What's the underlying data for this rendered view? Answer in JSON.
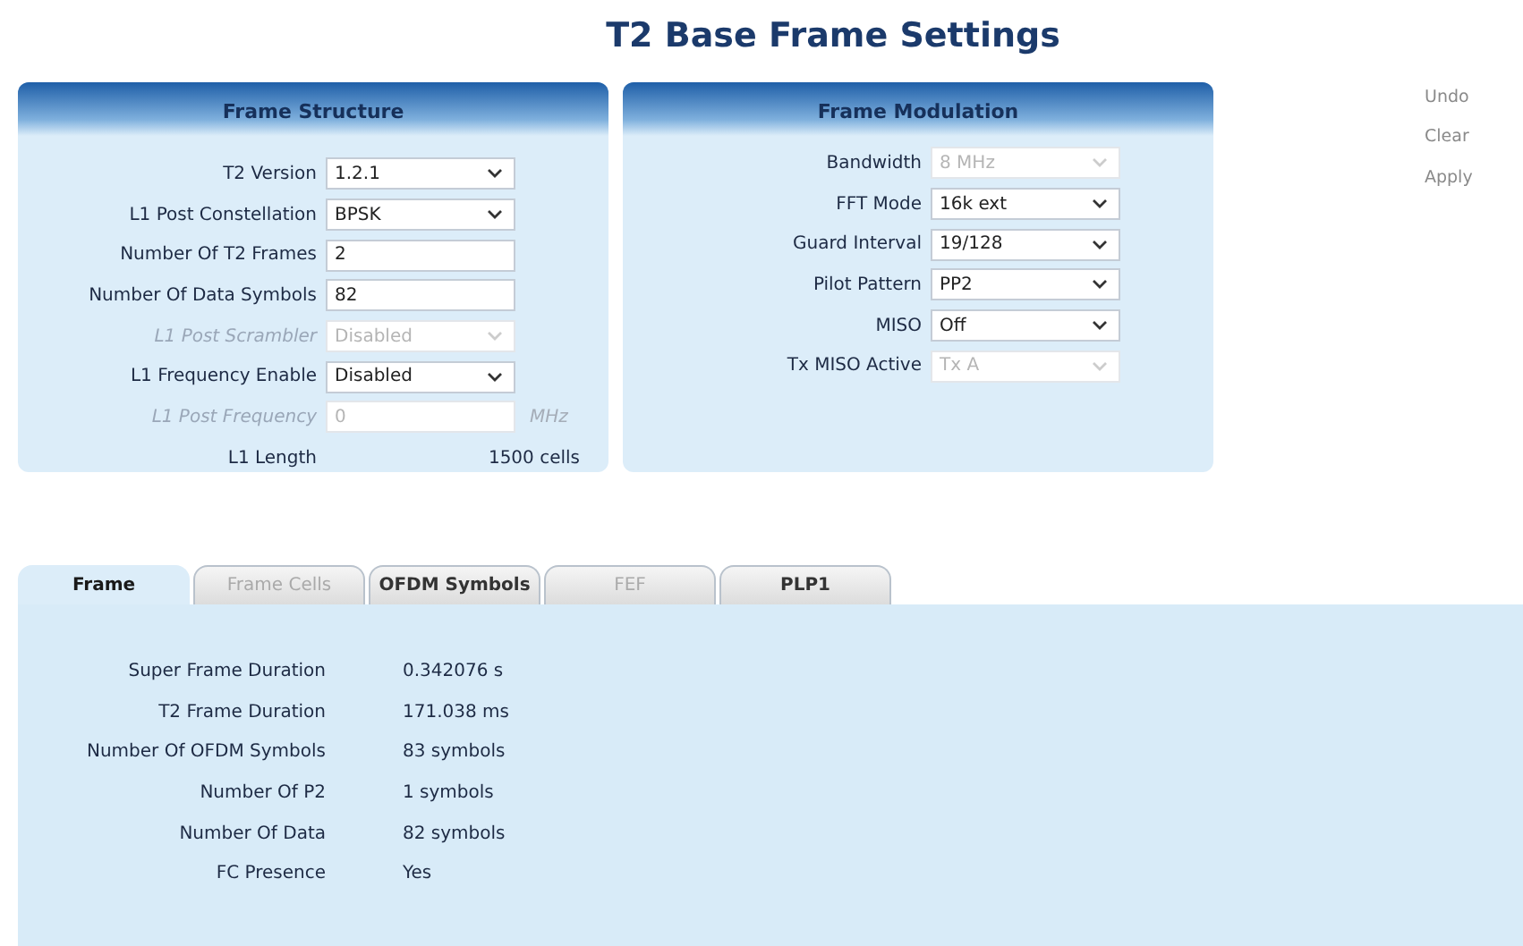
{
  "title": "T2 Base Frame Settings",
  "panels": [
    {
      "title": "Frame Structure",
      "fields": [
        {
          "label": "T2 Version",
          "kind": "select",
          "value": "1.2.1",
          "disabled": false
        },
        {
          "label": "L1 Post Constellation",
          "kind": "select",
          "value": "BPSK",
          "disabled": false
        },
        {
          "label": "Number Of T2 Frames",
          "kind": "input",
          "value": "2",
          "disabled": false
        },
        {
          "label": "Number Of Data Symbols",
          "kind": "input",
          "value": "82",
          "disabled": false
        },
        {
          "label": "L1 Post Scrambler",
          "kind": "select",
          "value": "Disabled",
          "disabled": true,
          "label_dimmed": true
        },
        {
          "label": "L1 Frequency Enable",
          "kind": "select",
          "value": "Disabled",
          "disabled": false
        },
        {
          "label": "L1 Post Frequency",
          "kind": "input",
          "value": "0",
          "unit": "MHz",
          "disabled": true,
          "label_dimmed": true
        },
        {
          "label": "L1 Length",
          "kind": "static",
          "value": "1500 cells"
        }
      ]
    },
    {
      "title": "Frame Modulation",
      "fields": [
        {
          "label": "Bandwidth",
          "kind": "select",
          "value": "8 MHz",
          "disabled": true
        },
        {
          "label": "FFT Mode",
          "kind": "select",
          "value": "16k ext",
          "disabled": false
        },
        {
          "label": "Guard Interval",
          "kind": "select",
          "value": "19/128",
          "disabled": false
        },
        {
          "label": "Pilot Pattern",
          "kind": "select",
          "value": "PP2",
          "disabled": false
        },
        {
          "label": "MISO",
          "kind": "select",
          "value": "Off",
          "disabled": false
        },
        {
          "label": "Tx MISO Active",
          "kind": "select",
          "value": "Tx A",
          "disabled": true
        }
      ]
    }
  ],
  "actions": [
    "Undo",
    "Clear",
    "Apply"
  ],
  "tabs": [
    {
      "label": "Frame",
      "selected": true,
      "disabled": false
    },
    {
      "label": "Frame Cells",
      "selected": false,
      "disabled": true
    },
    {
      "label": "OFDM Symbols",
      "selected": false,
      "disabled": false
    },
    {
      "label": "FEF",
      "selected": false,
      "disabled": true
    },
    {
      "label": "PLP1",
      "selected": false,
      "disabled": false
    }
  ],
  "results": [
    {
      "label": "Super Frame Duration",
      "value": "0.342076 s"
    },
    {
      "label": "T2 Frame Duration",
      "value": "171.038 ms"
    },
    {
      "label": "Number Of OFDM Symbols",
      "value": "83 symbols"
    },
    {
      "label": "Number Of P2",
      "value": "1 symbols"
    },
    {
      "label": "Number Of Data",
      "value": "82 symbols"
    },
    {
      "label": "FC Presence",
      "value": "Yes"
    }
  ]
}
